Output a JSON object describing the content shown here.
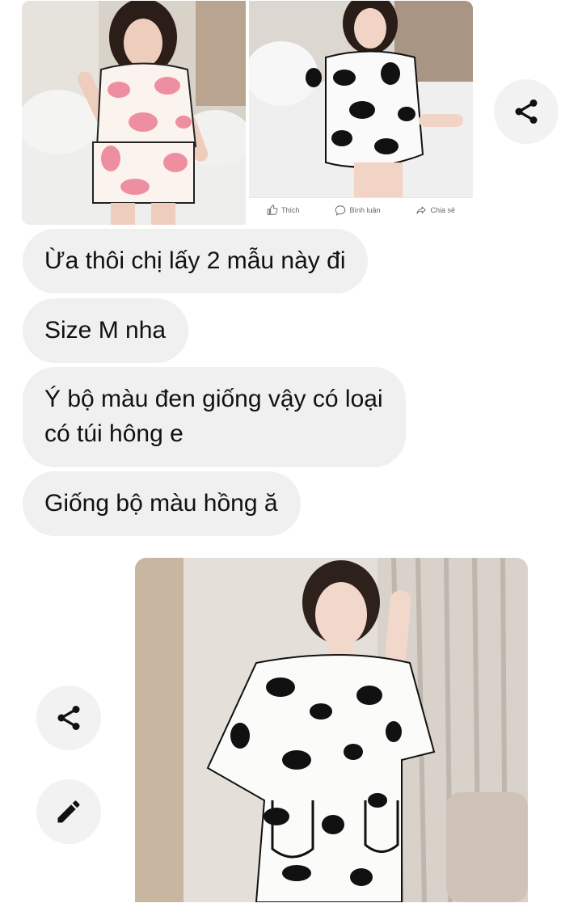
{
  "post_actions": {
    "like": "Thích",
    "comment": "Bình luận",
    "share": "Chia sẻ"
  },
  "messages": [
    {
      "lines": [
        "Ừa thôi chị lấy 2 mẫu này đi"
      ]
    },
    {
      "lines": [
        "Size M nha"
      ]
    },
    {
      "lines": [
        "Ý bộ màu đen giống vậy có loại",
        "có túi hông e"
      ]
    },
    {
      "lines": [
        "Giống bộ màu hồng ă"
      ]
    }
  ],
  "icons": {
    "share": "share-icon",
    "edit": "pencil-icon",
    "like": "thumbs-up-icon",
    "comment": "comment-icon",
    "forward": "forward-arrow-icon"
  },
  "colors": {
    "bubble": "#f0f0f0",
    "text": "#111111",
    "button_bg": "#f2f2f2",
    "icon": "#111111"
  }
}
